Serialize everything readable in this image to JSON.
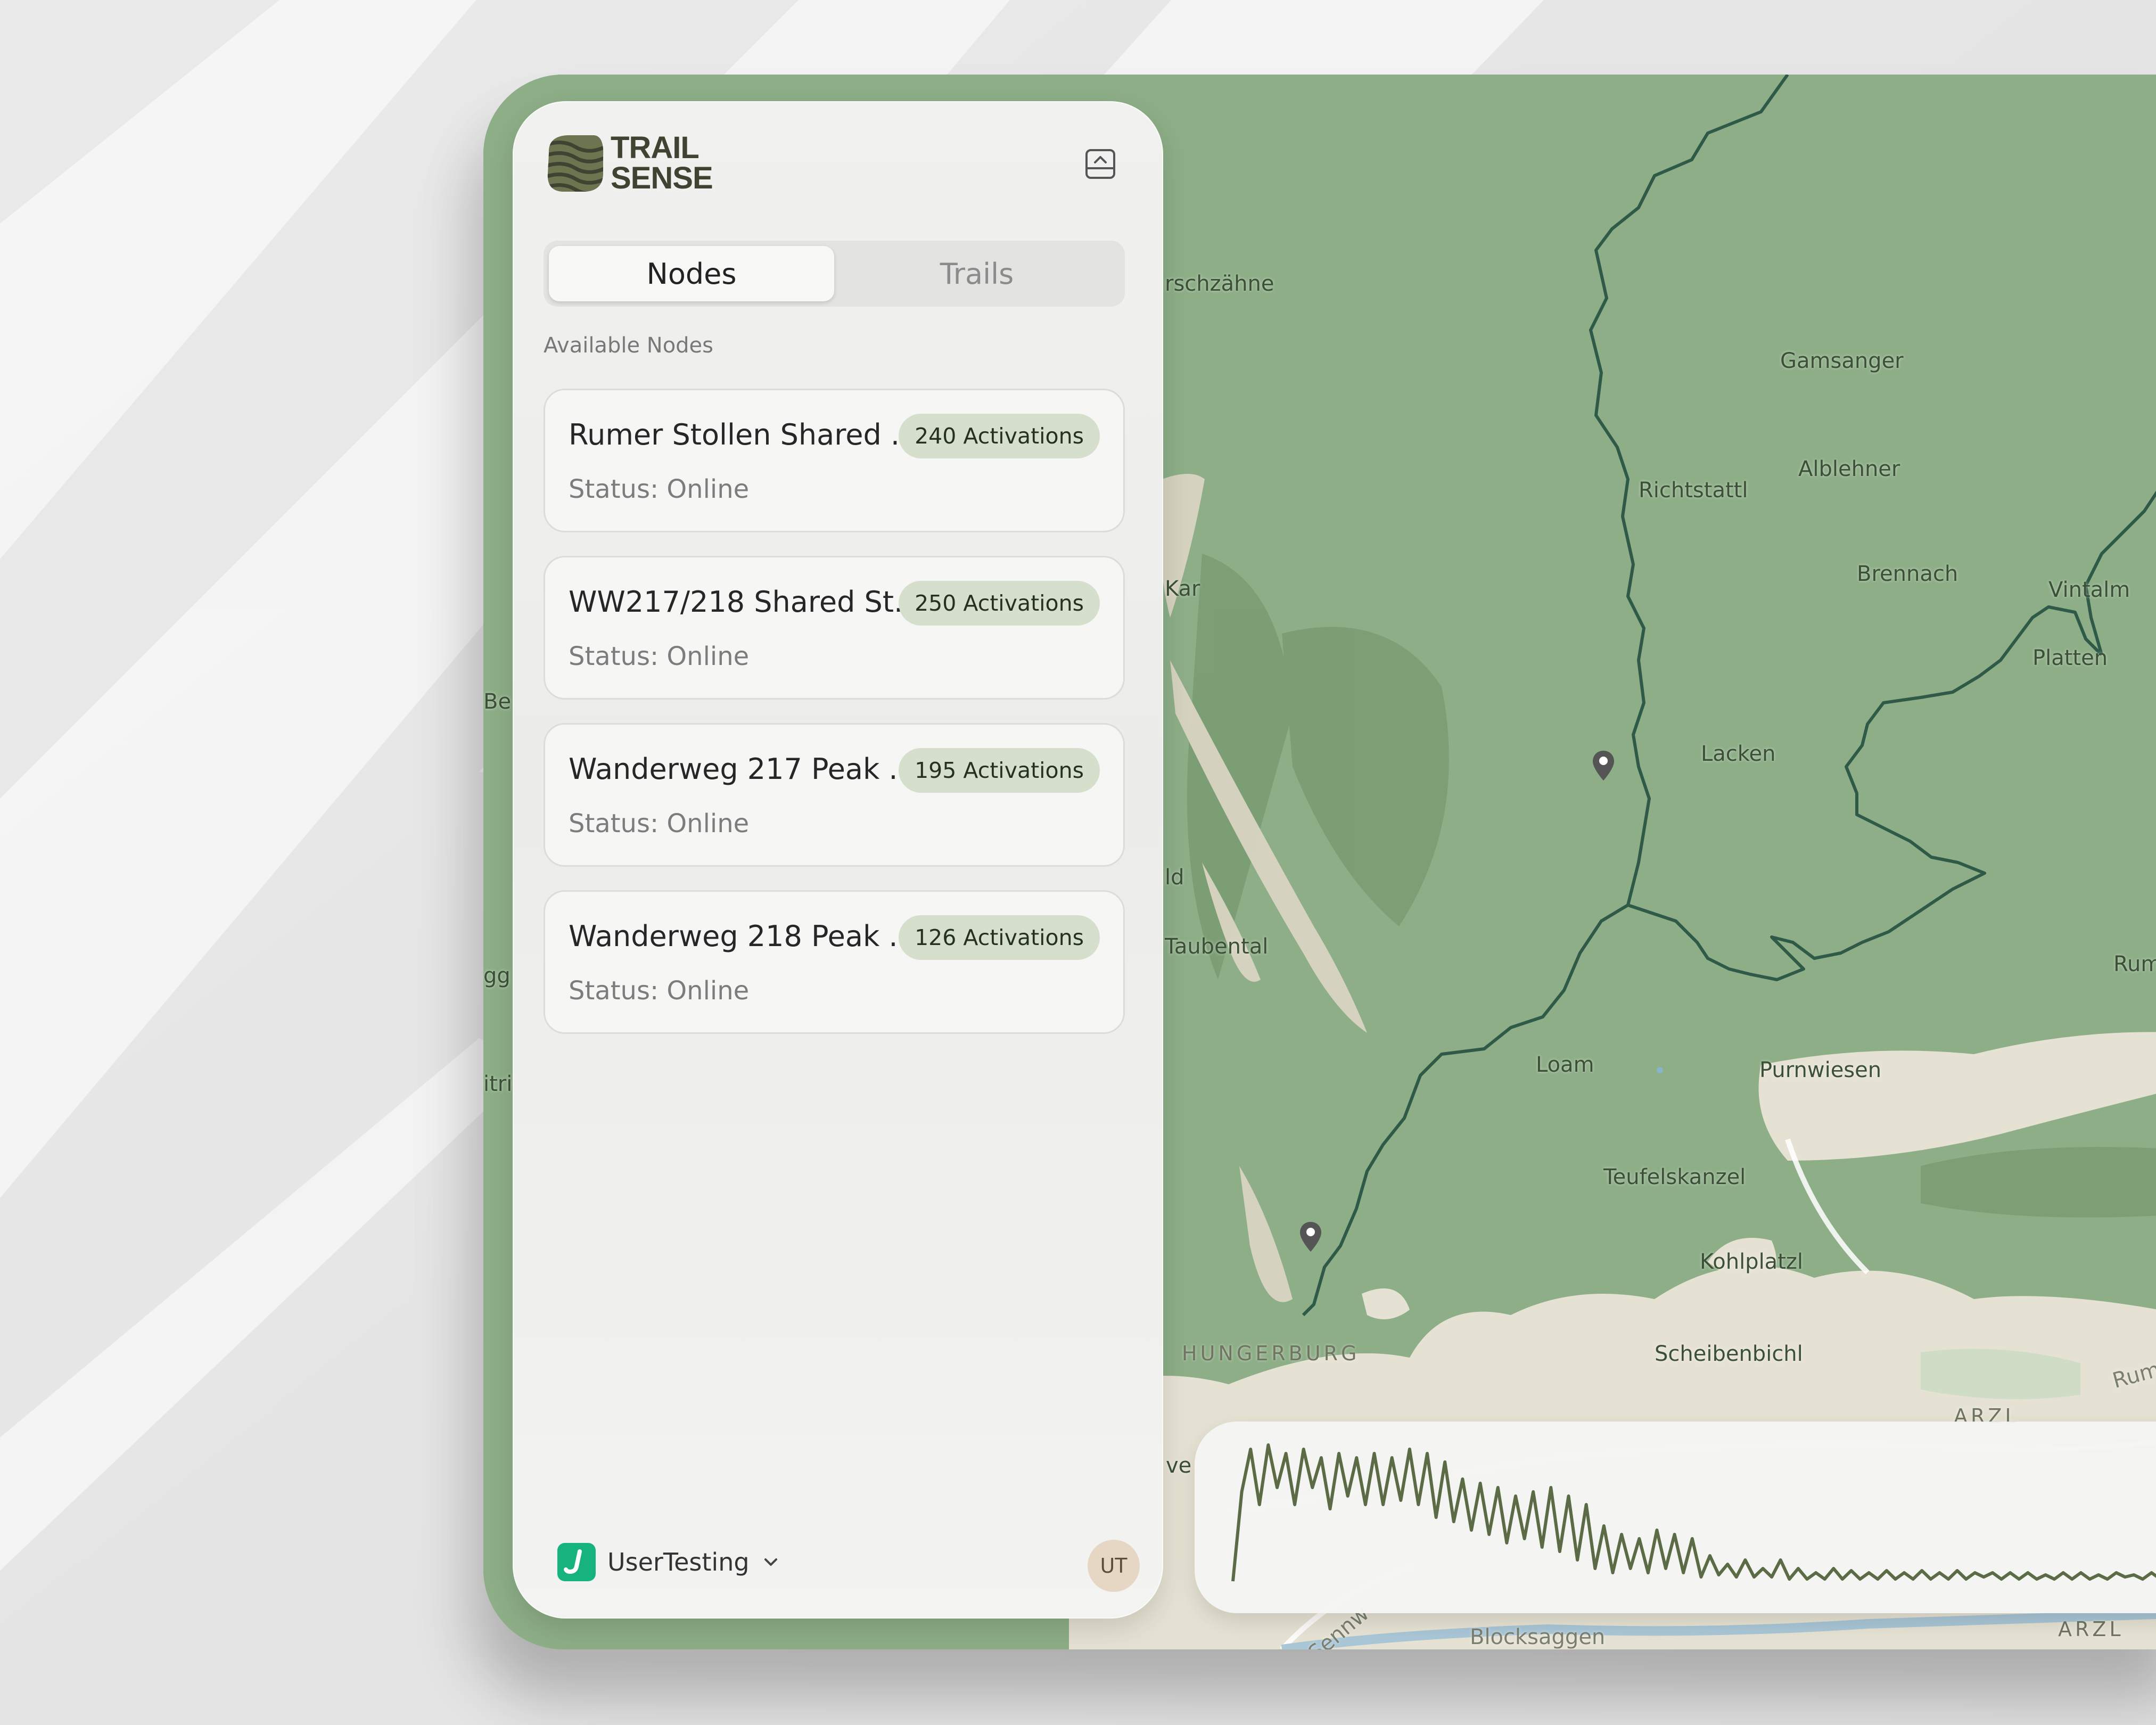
{
  "app": {
    "logo_line1": "TRAIL",
    "logo_line2": "SENSE",
    "tabs": [
      {
        "label": "Nodes",
        "active": true
      },
      {
        "label": "Trails",
        "active": false
      }
    ],
    "section_label": "Available Nodes",
    "nodes": [
      {
        "name": "Rumer Stollen Shared ...",
        "activations": "240 Activations",
        "status": "Status: Online"
      },
      {
        "name": "WW217/218 Shared St...",
        "activations": "250 Activations",
        "status": "Status: Online"
      },
      {
        "name": "Wanderweg 217 Peak ...",
        "activations": "195 Activations",
        "status": "Status: Online"
      },
      {
        "name": "Wanderweg 218 Peak ...",
        "activations": "126 Activations",
        "status": "Status: Online"
      }
    ],
    "workspace": {
      "name": "UserTesting",
      "icon": "workspace-logo-icon"
    },
    "avatar": "UT"
  },
  "map": {
    "labels": {
      "rschzahne": "rschzähne",
      "gamsanger": "Gamsanger",
      "richtstattl": "Richtstattl",
      "alblehner": "Alblehner",
      "brennach": "Brennach",
      "vintalm": "Vintalm",
      "kar": "Kar",
      "platten": "Platten",
      "be": "Be",
      "lacken": "Lacken",
      "ld": "ld",
      "taubental": "Taubental",
      "gg": "gg",
      "rum_edge": "Rum",
      "loam": "Loam",
      "purnwiesen": "Purnwiesen",
      "itri": "itri",
      "teufelskanzel": "Teufelskanzel",
      "kohlplatzl": "Kohlplatzl",
      "hungerburg": "HUNGERBURG",
      "scheibenbichl": "Scheibenbichl",
      "rum_road": "Rum",
      "arzl_top": "ARZL",
      "ve": "ve",
      "sennw": "Sennw",
      "blocksaggen": "Blocksaggen",
      "arzl_bottom": "ARZL"
    },
    "colors": {
      "forest": "#8dae87",
      "dark_forest": "#7a9c73",
      "urban": "#e6e2d3",
      "trail": "#2f5a48",
      "pin": "#555555"
    }
  },
  "activity_chart": {
    "type": "line",
    "color": "#5a6b45",
    "values": [
      0,
      42,
      62,
      36,
      64,
      44,
      60,
      36,
      62,
      44,
      58,
      34,
      60,
      40,
      58,
      36,
      60,
      36,
      58,
      38,
      62,
      36,
      60,
      30,
      56,
      28,
      48,
      24,
      46,
      22,
      44,
      18,
      40,
      20,
      42,
      16,
      44,
      14,
      40,
      10,
      36,
      6,
      26,
      4,
      22,
      6,
      20,
      4,
      24,
      6,
      22,
      4,
      20,
      2,
      12,
      3,
      8,
      2,
      10,
      2,
      6,
      2,
      10,
      1,
      6,
      1,
      4,
      1,
      6,
      1,
      5,
      1,
      4,
      1,
      5,
      1,
      4,
      1,
      5,
      1,
      4,
      1,
      5,
      1,
      4,
      2,
      4,
      1,
      4,
      1,
      4,
      1,
      3,
      1,
      4,
      1,
      4,
      1,
      3,
      1,
      4,
      2,
      3,
      1,
      4,
      1,
      3,
      1,
      3
    ]
  }
}
